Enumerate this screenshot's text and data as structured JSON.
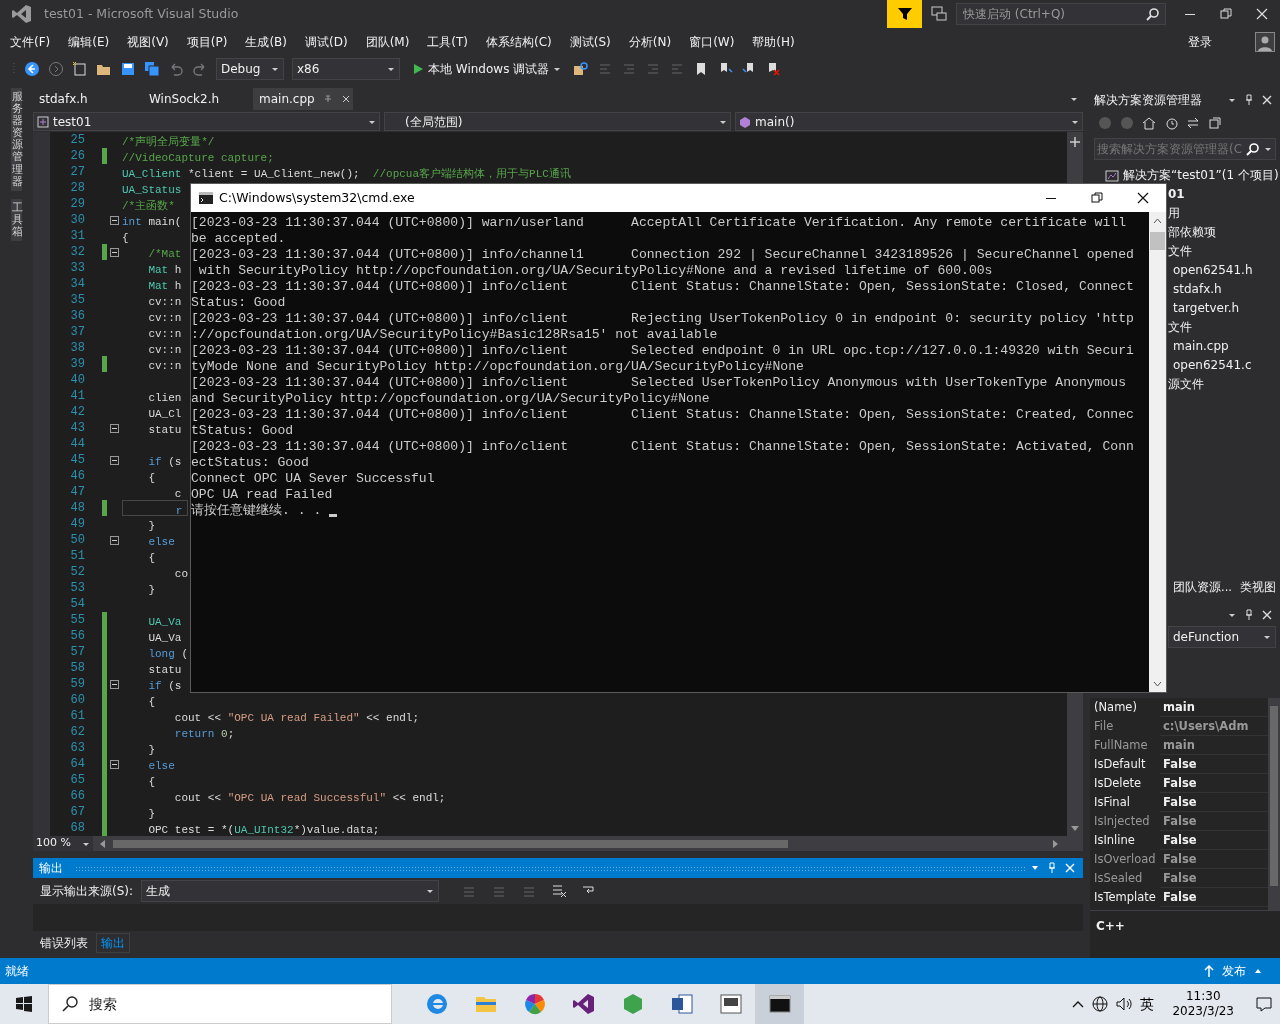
{
  "window": {
    "title": "test01 - Microsoft Visual Studio"
  },
  "quick_launch": {
    "placeholder": "快速启动 (Ctrl+Q)"
  },
  "menu": [
    "文件(F)",
    "编辑(E)",
    "视图(V)",
    "项目(P)",
    "生成(B)",
    "调试(D)",
    "团队(M)",
    "工具(T)",
    "体系结构(C)",
    "测试(S)",
    "分析(N)",
    "窗口(W)",
    "帮助(H)"
  ],
  "account": "登录",
  "toolbar": {
    "configuration": "Debug",
    "platform": "x86",
    "start": "本地 Windows 调试器"
  },
  "side_tabs": [
    "服务器资源管理器",
    "工具箱"
  ],
  "document_tabs": [
    {
      "label": "stdafx.h",
      "selected": false
    },
    {
      "label": "WinSock2.h",
      "selected": false
    },
    {
      "label": "main.cpp",
      "selected": true
    }
  ],
  "navigation": {
    "project": "test01",
    "scope": "(全局范围)",
    "member": "main()"
  },
  "code_lines": [
    {
      "number": "25",
      "changed": false,
      "fold": false,
      "current": false,
      "tokens": [
        {
          "text": "/*声明全局变量*/",
          "kind": "comment"
        }
      ]
    },
    {
      "number": "26",
      "changed": true,
      "fold": false,
      "current": false,
      "tokens": [
        {
          "text": "//VideoCapture capture;",
          "kind": "comment"
        }
      ]
    },
    {
      "number": "27",
      "changed": false,
      "fold": false,
      "current": false,
      "tokens": [
        {
          "text": "UA_Client",
          "kind": "type"
        },
        {
          "text": " *client = UA_Client_new();  ",
          "kind": "plain"
        },
        {
          "text": "//opcua客户端结构体，用于与PLC通讯",
          "kind": "comment"
        }
      ]
    },
    {
      "number": "28",
      "changed": false,
      "fold": false,
      "current": false,
      "tokens": [
        {
          "text": "UA_Status",
          "kind": "type"
        }
      ]
    },
    {
      "number": "29",
      "changed": false,
      "fold": false,
      "current": false,
      "tokens": [
        {
          "text": "/*主函数*",
          "kind": "comment"
        }
      ]
    },
    {
      "number": "30",
      "changed": false,
      "fold": true,
      "current": false,
      "tokens": [
        {
          "text": "int",
          "kind": "keyword"
        },
        {
          "text": " main(",
          "kind": "plain"
        }
      ]
    },
    {
      "number": "31",
      "changed": false,
      "fold": false,
      "current": false,
      "tokens": [
        {
          "text": "{",
          "kind": "plain"
        }
      ]
    },
    {
      "number": "32",
      "changed": true,
      "fold": true,
      "current": false,
      "tokens": [
        {
          "text": "    /*Mat",
          "kind": "comment"
        }
      ]
    },
    {
      "number": "33",
      "changed": false,
      "fold": false,
      "current": false,
      "tokens": [
        {
          "text": "    Mat",
          "kind": "type"
        },
        {
          "text": " h",
          "kind": "plain"
        }
      ]
    },
    {
      "number": "34",
      "changed": false,
      "fold": false,
      "current": false,
      "tokens": [
        {
          "text": "    Mat",
          "kind": "type"
        },
        {
          "text": " h",
          "kind": "plain"
        }
      ]
    },
    {
      "number": "35",
      "changed": false,
      "fold": false,
      "current": false,
      "tokens": [
        {
          "text": "    cv::n",
          "kind": "plain"
        }
      ]
    },
    {
      "number": "36",
      "changed": false,
      "fold": false,
      "current": false,
      "tokens": [
        {
          "text": "    cv::n",
          "kind": "plain"
        }
      ]
    },
    {
      "number": "37",
      "changed": false,
      "fold": false,
      "current": false,
      "tokens": [
        {
          "text": "    cv::n",
          "kind": "plain"
        }
      ]
    },
    {
      "number": "38",
      "changed": false,
      "fold": false,
      "current": false,
      "tokens": [
        {
          "text": "    cv::n",
          "kind": "plain"
        }
      ]
    },
    {
      "number": "39",
      "changed": true,
      "fold": false,
      "current": false,
      "tokens": [
        {
          "text": "    cv::n",
          "kind": "plain"
        }
      ]
    },
    {
      "number": "40",
      "changed": false,
      "fold": false,
      "current": false
    },
    {
      "number": "41",
      "changed": false,
      "fold": false,
      "current": false,
      "tokens": [
        {
          "text": "    clien",
          "kind": "plain"
        }
      ]
    },
    {
      "number": "42",
      "changed": false,
      "fold": false,
      "current": false,
      "tokens": [
        {
          "text": "    UA_Cl",
          "kind": "plain"
        }
      ]
    },
    {
      "number": "43",
      "changed": false,
      "fold": true,
      "current": false,
      "tokens": [
        {
          "text": "    statu",
          "kind": "plain"
        }
      ]
    },
    {
      "number": "44",
      "changed": false,
      "fold": false,
      "current": false
    },
    {
      "number": "45",
      "changed": false,
      "fold": true,
      "current": false,
      "tokens": [
        {
          "text": "    if",
          "kind": "keyword"
        },
        {
          "text": " (s",
          "kind": "plain"
        }
      ]
    },
    {
      "number": "46",
      "changed": false,
      "fold": false,
      "current": false,
      "tokens": [
        {
          "text": "    {",
          "kind": "plain"
        }
      ]
    },
    {
      "number": "47",
      "changed": false,
      "fold": false,
      "current": false,
      "tokens": [
        {
          "text": "        c",
          "kind": "plain"
        }
      ]
    },
    {
      "number": "48",
      "changed": true,
      "fold": false,
      "current": true,
      "tokens": [
        {
          "text": "        r",
          "kind": "keyword"
        }
      ]
    },
    {
      "number": "49",
      "changed": false,
      "fold": false,
      "current": false,
      "tokens": [
        {
          "text": "    }",
          "kind": "plain"
        }
      ]
    },
    {
      "number": "50",
      "changed": false,
      "fold": true,
      "current": false,
      "tokens": [
        {
          "text": "    else",
          "kind": "keyword"
        }
      ]
    },
    {
      "number": "51",
      "changed": false,
      "fold": false,
      "current": false,
      "tokens": [
        {
          "text": "    {",
          "kind": "plain"
        }
      ]
    },
    {
      "number": "52",
      "changed": false,
      "fold": false,
      "current": false,
      "tokens": [
        {
          "text": "        co",
          "kind": "plain"
        }
      ]
    },
    {
      "number": "53",
      "changed": false,
      "fold": false,
      "current": false,
      "tokens": [
        {
          "text": "    }",
          "kind": "plain"
        }
      ]
    },
    {
      "number": "54",
      "changed": false,
      "fold": false,
      "current": false
    },
    {
      "number": "55",
      "changed": true,
      "fold": false,
      "current": false,
      "tokens": [
        {
          "text": "    UA_Va",
          "kind": "type"
        }
      ]
    },
    {
      "number": "56",
      "changed": true,
      "fold": false,
      "current": false,
      "tokens": [
        {
          "text": "    UA_Va",
          "kind": "plain"
        }
      ]
    },
    {
      "number": "57",
      "changed": true,
      "fold": false,
      "current": false,
      "tokens": [
        {
          "text": "    long",
          "kind": "keyword"
        },
        {
          "text": " (",
          "kind": "plain"
        }
      ]
    },
    {
      "number": "58",
      "changed": true,
      "fold": false,
      "current": false,
      "tokens": [
        {
          "text": "    statu",
          "kind": "plain"
        }
      ]
    },
    {
      "number": "59",
      "changed": true,
      "fold": true,
      "current": false,
      "tokens": [
        {
          "text": "    if",
          "kind": "keyword"
        },
        {
          "text": " (s",
          "kind": "plain"
        }
      ]
    },
    {
      "number": "60",
      "changed": true,
      "fold": false,
      "current": false,
      "tokens": [
        {
          "text": "    {",
          "kind": "plain"
        }
      ]
    },
    {
      "number": "61",
      "changed": true,
      "fold": false,
      "current": false,
      "tokens": [
        {
          "text": "        cout << ",
          "kind": "plain"
        },
        {
          "text": "\"OPC UA read Failed\"",
          "kind": "string"
        },
        {
          "text": " << endl;",
          "kind": "plain"
        }
      ]
    },
    {
      "number": "62",
      "changed": true,
      "fold": false,
      "current": false,
      "tokens": [
        {
          "text": "        return",
          "kind": "keyword"
        },
        {
          "text": " 0",
          "kind": "number"
        },
        {
          "text": ";",
          "kind": "plain"
        }
      ]
    },
    {
      "number": "63",
      "changed": true,
      "fold": false,
      "current": false,
      "tokens": [
        {
          "text": "    }",
          "kind": "plain"
        }
      ]
    },
    {
      "number": "64",
      "changed": true,
      "fold": true,
      "current": false,
      "tokens": [
        {
          "text": "    else",
          "kind": "keyword"
        }
      ]
    },
    {
      "number": "65",
      "changed": true,
      "fold": false,
      "current": false,
      "tokens": [
        {
          "text": "    {",
          "kind": "plain"
        }
      ]
    },
    {
      "number": "66",
      "changed": true,
      "fold": false,
      "current": false,
      "tokens": [
        {
          "text": "        cout << ",
          "kind": "plain"
        },
        {
          "text": "\"OPC UA read Successful\"",
          "kind": "string"
        },
        {
          "text": " << endl;",
          "kind": "plain"
        }
      ]
    },
    {
      "number": "67",
      "changed": true,
      "fold": false,
      "current": false,
      "tokens": [
        {
          "text": "    }",
          "kind": "plain"
        }
      ]
    },
    {
      "number": "68",
      "changed": true,
      "fold": false,
      "current": false,
      "tokens": [
        {
          "text": "    OPC test = *(",
          "kind": "plain"
        },
        {
          "text": "UA_UInt32",
          "kind": "type"
        },
        {
          "text": "*)value.data;",
          "kind": "plain"
        }
      ]
    }
  ],
  "zoom": "100 %",
  "output": {
    "title": "输出",
    "source_label": "显示输出来源(S):",
    "source": "生成"
  },
  "bottom_tabs": [
    {
      "label": "错误列表",
      "selected": false
    },
    {
      "label": "输出",
      "selected": true
    }
  ],
  "console": {
    "title": "C:\\Windows\\system32\\cmd.exe",
    "lines": [
      "[2023-03-23 11:30:37.044 (UTC+0800)] warn/userland      AcceptAll Certificate Verification. Any remote certificate will",
      "be accepted.",
      "[2023-03-23 11:30:37.044 (UTC+0800)] info/channel1      Connection 292 | SecureChannel 3423189526 | SecureChannel opened",
      " with SecurityPolicy http://opcfoundation.org/UA/SecurityPolicy#None and a revised lifetime of 600.00s",
      "[2023-03-23 11:30:37.044 (UTC+0800)] info/client        Client Status: ChannelState: Open, SessionState: Closed, Connect",
      "Status: Good",
      "[2023-03-23 11:30:37.044 (UTC+0800)] info/client        Rejecting UserTokenPolicy 0 in endpoint 0: security policy 'http",
      "://opcfoundation.org/UA/SecurityPolicy#Basic128Rsa15' not available",
      "[2023-03-23 11:30:37.044 (UTC+0800)] info/client        Selected endpoint 0 in URL opc.tcp://127.0.0.1:49320 with Securi",
      "tyMode None and SecurityPolicy http://opcfoundation.org/UA/SecurityPolicy#None",
      "[2023-03-23 11:30:37.044 (UTC+0800)] info/client        Selected UserTokenPolicy Anonymous with UserTokenType Anonymous",
      "and SecurityPolicy http://opcfoundation.org/UA/SecurityPolicy#None",
      "[2023-03-23 11:30:37.044 (UTC+0800)] info/client        Client Status: ChannelState: Open, SessionState: Created, Connec",
      "tStatus: Good",
      "[2023-03-23 11:30:37.044 (UTC+0800)] info/client        Client Status: ChannelState: Open, SessionState: Activated, Conn",
      "ectStatus: Good",
      "Connect OPC UA Sever Successful",
      "OPC UA read Failed",
      "请按任意键继续. . . "
    ]
  },
  "solution_explorer": {
    "title": "解决方案资源管理器",
    "search": {
      "placeholder": "搜索解决方案资源管理器(C"
    },
    "tree": [
      {
        "label": "解决方案“test01”(1 个项目)",
        "children": [
          {
            "label": "01",
            "children": [
              {
                "label": "用"
              },
              {
                "label": "部依赖项"
              },
              {
                "label": "文件",
                "children": [
                  {
                    "label": "open62541.h"
                  },
                  {
                    "label": "stdafx.h"
                  },
                  {
                    "label": "targetver.h"
                  }
                ]
              },
              {
                "label": "文件",
                "children": [
                  {
                    "label": "main.cpp"
                  },
                  {
                    "label": "open62541.c"
                  }
                ]
              },
              {
                "label": "源文件"
              }
            ]
          }
        ]
      }
    ],
    "tabs": [
      "团队资源...",
      "类视图"
    ]
  },
  "properties": {
    "selector": "deFunction",
    "rows": [
      {
        "name": "(Name)",
        "value": "main",
        "readonly": false
      },
      {
        "name": "File",
        "value": "c:\\Users\\Adm",
        "readonly": true
      },
      {
        "name": "FullName",
        "value": "main",
        "readonly": true
      },
      {
        "name": "IsDefault",
        "value": "False",
        "readonly": false
      },
      {
        "name": "IsDelete",
        "value": "False",
        "readonly": false
      },
      {
        "name": "IsFinal",
        "value": "False",
        "readonly": false
      },
      {
        "name": "IsInjected",
        "value": "False",
        "readonly": true
      },
      {
        "name": "IsInline",
        "value": "False",
        "readonly": false
      },
      {
        "name": "IsOverload",
        "value": "False",
        "readonly": true
      },
      {
        "name": "IsSealed",
        "value": "False",
        "readonly": true
      },
      {
        "name": "IsTemplate",
        "value": "False",
        "readonly": false
      }
    ],
    "description": "C++"
  },
  "status_bar": {
    "text": "就绪",
    "publish": "发布"
  },
  "taskbar": {
    "search": {
      "placeholder": "搜索"
    },
    "ime": "英",
    "time": "11:30",
    "date": "2023/3/23"
  }
}
